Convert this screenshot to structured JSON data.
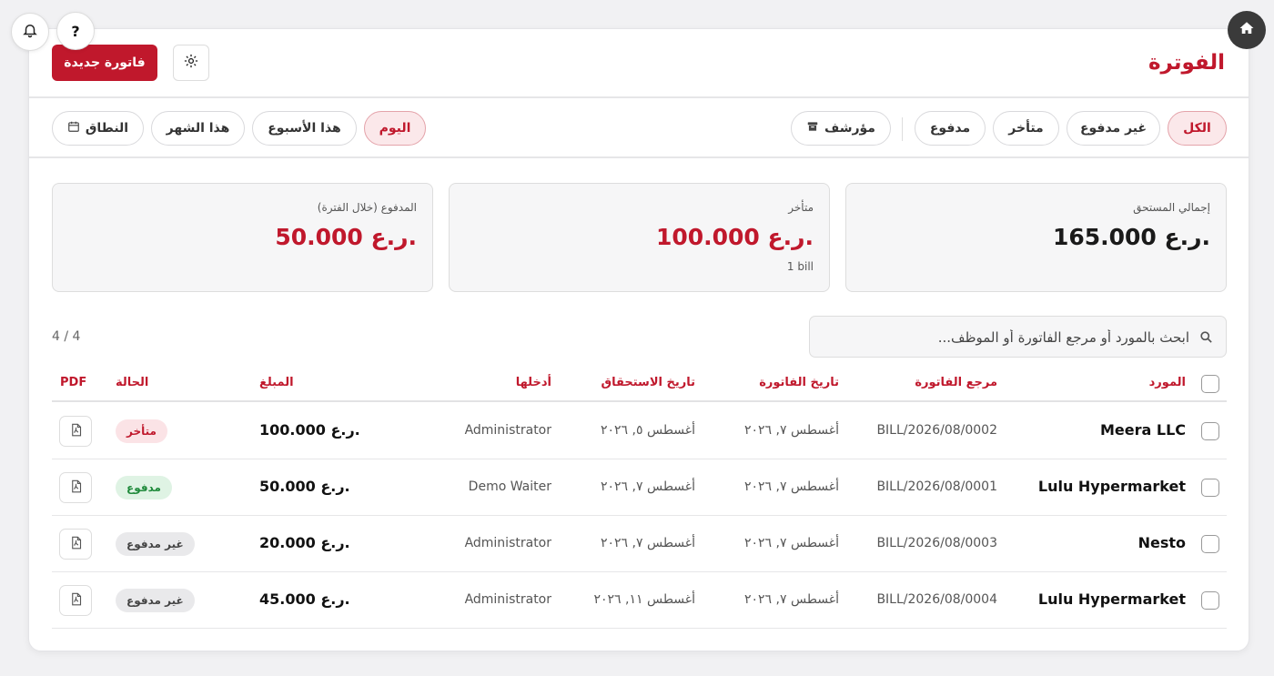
{
  "header": {
    "title": "الفوترة",
    "new_bill_label": "فاتورة جديدة",
    "help_label": "?"
  },
  "filters": {
    "status": [
      {
        "label": "الكل",
        "active": true
      },
      {
        "label": "غير مدفوع",
        "active": false
      },
      {
        "label": "متأخر",
        "active": false
      },
      {
        "label": "مدفوع",
        "active": false
      }
    ],
    "archived_label": "مؤرشف",
    "date": [
      {
        "label": "اليوم",
        "active": true
      },
      {
        "label": "هذا الأسبوع",
        "active": false
      },
      {
        "label": "هذا الشهر",
        "active": false
      }
    ],
    "range_label": "النطاق"
  },
  "stats": {
    "total_due": {
      "label": "إجمالي المستحق",
      "value": "165.000 ر.ع."
    },
    "overdue": {
      "label": "متأخر",
      "value": "100.000 ر.ع.",
      "sub": "1 bill"
    },
    "paid": {
      "label": "المدفوع (خلال الفترة)",
      "value": "50.000 ر.ع."
    }
  },
  "search": {
    "placeholder": "ابحث بالمورد أو مرجع الفاتورة أو الموظف..."
  },
  "count": "4 / 4",
  "table": {
    "columns": {
      "vendor": "المورد",
      "ref": "مرجع الفاتورة",
      "bill_date": "تاريخ الفاتورة",
      "due_date": "تاريخ الاستحقاق",
      "entered_by": "أدخلها",
      "amount": "المبلغ",
      "status": "الحالة",
      "pdf": "PDF"
    },
    "rows": [
      {
        "vendor": "Meera LLC",
        "ref": "BILL/2026/08/0002",
        "bill_date": "أغسطس ٧, ٢٠٢٦",
        "due_date": "أغسطس ٥, ٢٠٢٦",
        "entered_by": "Administrator",
        "amount": "100.000 ر.ع.",
        "status": "متأخر",
        "status_type": "overdue"
      },
      {
        "vendor": "Lulu Hypermarket",
        "ref": "BILL/2026/08/0001",
        "bill_date": "أغسطس ٧, ٢٠٢٦",
        "due_date": "أغسطس ٧, ٢٠٢٦",
        "entered_by": "Demo Waiter",
        "amount": "50.000 ر.ع.",
        "status": "مدفوع",
        "status_type": "paid"
      },
      {
        "vendor": "Nesto",
        "ref": "BILL/2026/08/0003",
        "bill_date": "أغسطس ٧, ٢٠٢٦",
        "due_date": "أغسطس ٧, ٢٠٢٦",
        "entered_by": "Administrator",
        "amount": "20.000 ر.ع.",
        "status": "غير مدفوع",
        "status_type": "unpaid"
      },
      {
        "vendor": "Lulu Hypermarket",
        "ref": "BILL/2026/08/0004",
        "bill_date": "أغسطس ٧, ٢٠٢٦",
        "due_date": "أغسطس ١١, ٢٠٢٦",
        "entered_by": "Administrator",
        "amount": "45.000 ر.ع.",
        "status": "غير مدفوع",
        "status_type": "unpaid"
      }
    ]
  },
  "colors": {
    "accent": "#c0182c",
    "paid": "#1f8a3b"
  }
}
